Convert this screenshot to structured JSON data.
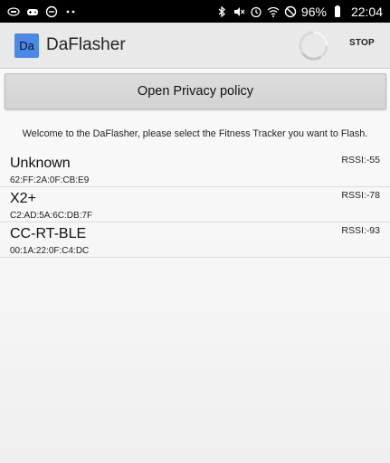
{
  "status_bar": {
    "battery": "96%",
    "time": "22:04",
    "icons_left": [
      "intel-icon",
      "game-controller-icon",
      "do-not-disturb-icon",
      "more-dots-icon"
    ],
    "icons_right": [
      "bluetooth-icon",
      "mute-icon",
      "alarm-icon",
      "wifi-icon",
      "blocked-icon",
      "battery-icon"
    ]
  },
  "app_bar": {
    "logo_text": "Da",
    "title": "DaFlasher",
    "stop_label": "STOP",
    "accent": "#4a89e8"
  },
  "privacy_button": {
    "label": "Open Privacy policy"
  },
  "welcome": {
    "text": "Welcome to the DaFlasher, please select the Fitness Tracker you want to Flash."
  },
  "devices": [
    {
      "name": "Unknown",
      "mac": "62:FF:2A:0F:CB:E9",
      "rssi": "RSSI:-55"
    },
    {
      "name": "X2+",
      "mac": "C2:AD:5A:6C:DB:7F",
      "rssi": "RSSI:-78"
    },
    {
      "name": "CC-RT-BLE",
      "mac": "00:1A:22:0F:C4:DC",
      "rssi": "RSSI:-93"
    }
  ]
}
